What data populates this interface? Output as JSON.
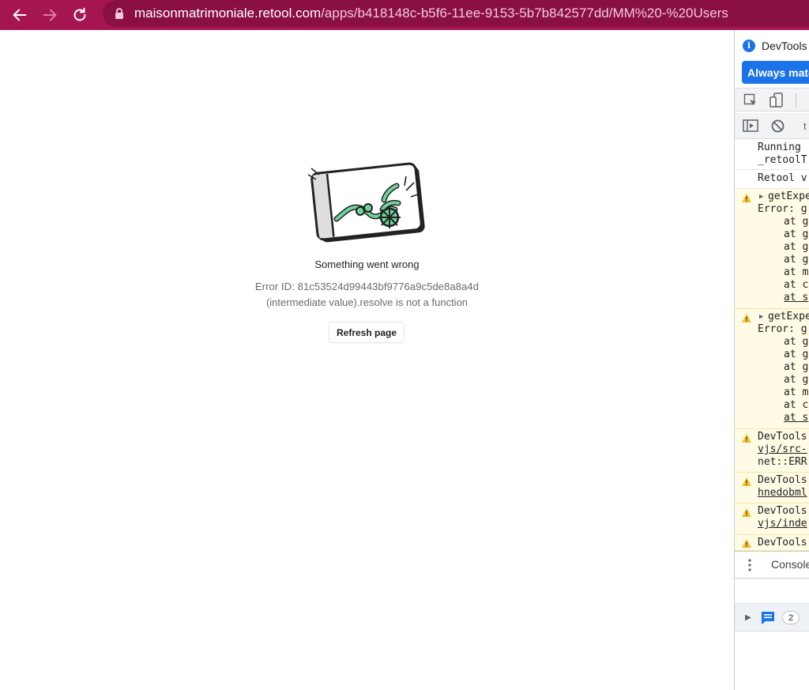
{
  "browser": {
    "url_host": "maisonmatrimoniale.retool.com",
    "url_path": "/apps/b418148c-b5f6-11ee-9153-5b7b842577dd/MM%20-%20Users",
    "bar_color": "#a51650"
  },
  "error_page": {
    "title": "Something went wrong",
    "error_id": "Error ID: 81c53524d99443bf9776a9c5de8a8a4d",
    "message": "(intermediate value).resolve is not a function",
    "refresh_label": "Refresh page"
  },
  "devtools": {
    "title": "DevTools",
    "always_button": "Always match",
    "toolbar_filter": "t",
    "console_lines": [
      {
        "id": "r1a",
        "text": "Running"
      },
      {
        "id": "r1b",
        "text": "_retoolT"
      },
      {
        "id": "r2",
        "text": "Retool v"
      },
      {
        "id": "w1a",
        "text": "getExpe"
      },
      {
        "id": "w1b",
        "text": "Error: g"
      },
      {
        "id": "w1c",
        "text": "at g"
      },
      {
        "id": "w1d",
        "text": "at g"
      },
      {
        "id": "w1e",
        "text": "at g"
      },
      {
        "id": "w1f",
        "text": "at g"
      },
      {
        "id": "w1g",
        "text": "at m"
      },
      {
        "id": "w1h",
        "text": "at c"
      },
      {
        "id": "w1i",
        "text": "at s"
      },
      {
        "id": "w2a",
        "text": "getExpe"
      },
      {
        "id": "w2b",
        "text": "Error: g"
      },
      {
        "id": "w2c",
        "text": "at g"
      },
      {
        "id": "w2d",
        "text": "at g"
      },
      {
        "id": "w2e",
        "text": "at g"
      },
      {
        "id": "w2f",
        "text": "at g"
      },
      {
        "id": "w2g",
        "text": "at m"
      },
      {
        "id": "w2h",
        "text": "at c"
      },
      {
        "id": "w2i",
        "text": "at s"
      },
      {
        "id": "w3a",
        "text": "DevTools"
      },
      {
        "id": "w3b",
        "text": "vjs/src-"
      },
      {
        "id": "w3c",
        "text": "net::ERR"
      },
      {
        "id": "w4a",
        "text": "DevTools"
      },
      {
        "id": "w4b",
        "text": "hnedobml"
      },
      {
        "id": "w5a",
        "text": "DevTools"
      },
      {
        "id": "w5b",
        "text": "vjs/inde"
      },
      {
        "id": "w6a",
        "text": "DevTools"
      }
    ],
    "bottom_tab": "Console",
    "message_count": "2",
    "accent": "#1a73e8",
    "warning_color": "#f2c12e"
  }
}
